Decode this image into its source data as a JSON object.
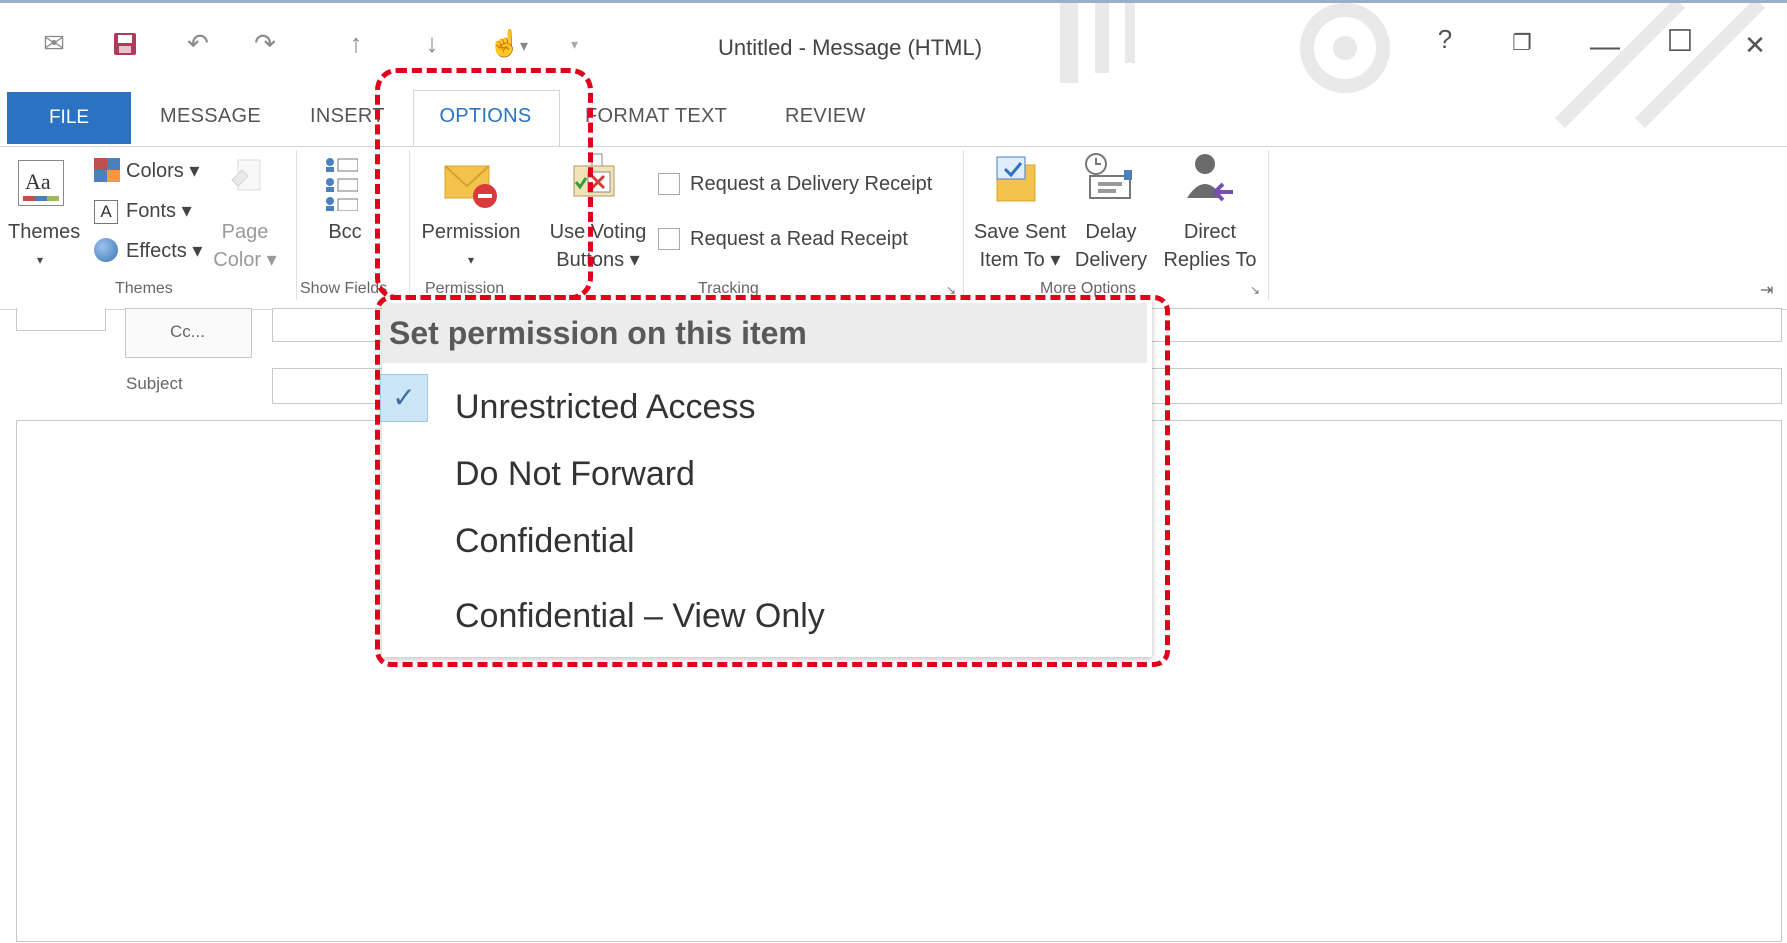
{
  "window": {
    "title": "Untitled - Message (HTML)",
    "help": "?",
    "restore": "❐",
    "minimize": "—",
    "maximize": "☐",
    "close": "✕"
  },
  "quick_access": {
    "envelope": "✉",
    "save": "💾",
    "undo": "↶",
    "redo": "↷",
    "up": "↑",
    "down": "↓",
    "touch": "☝",
    "touch_arrow": "▾",
    "customize": "▾"
  },
  "tabs": [
    {
      "label": "FILE"
    },
    {
      "label": "MESSAGE"
    },
    {
      "label": "INSERT"
    },
    {
      "label": "OPTIONS"
    },
    {
      "label": "FORMAT TEXT"
    },
    {
      "label": "REVIEW"
    }
  ],
  "ribbon": {
    "themes": {
      "themes_label": "Themes",
      "themes_arrow": "▾",
      "colors": "Colors ▾",
      "fonts": "Fonts ▾",
      "effects": "Effects ▾",
      "page_label": "Page",
      "color_label": "Color ▾",
      "group": "Themes"
    },
    "show_fields": {
      "bcc": "Bcc",
      "group": "Show Fields"
    },
    "permission": {
      "label": "Permission",
      "arrow": "▾",
      "group": "Permission"
    },
    "tracking": {
      "voting_line1": "Use Voting",
      "voting_line2": "Buttons ▾",
      "delivery_receipt": "Request a Delivery Receipt",
      "read_receipt": "Request a Read Receipt",
      "group": "Tracking"
    },
    "more_options": {
      "save_sent_1": "Save Sent",
      "save_sent_2": "Item To ▾",
      "delay_1": "Delay",
      "delay_2": "Delivery",
      "direct_1": "Direct",
      "direct_2": "Replies To",
      "group": "More Options"
    },
    "pin": "⇥"
  },
  "fields": {
    "cc_label": "Cc...",
    "subject_label": "Subject"
  },
  "permission_menu": {
    "header": "Set permission on this item",
    "check": "✓",
    "items": [
      {
        "label": "Unrestricted Access",
        "checked": true
      },
      {
        "label": "Do Not Forward",
        "checked": false
      },
      {
        "label": "Confidential",
        "checked": false
      },
      {
        "label": "Confidential – View Only",
        "checked": false
      }
    ]
  },
  "colors": {
    "accent": "#2b72c2",
    "highlight": "#e0001b"
  }
}
